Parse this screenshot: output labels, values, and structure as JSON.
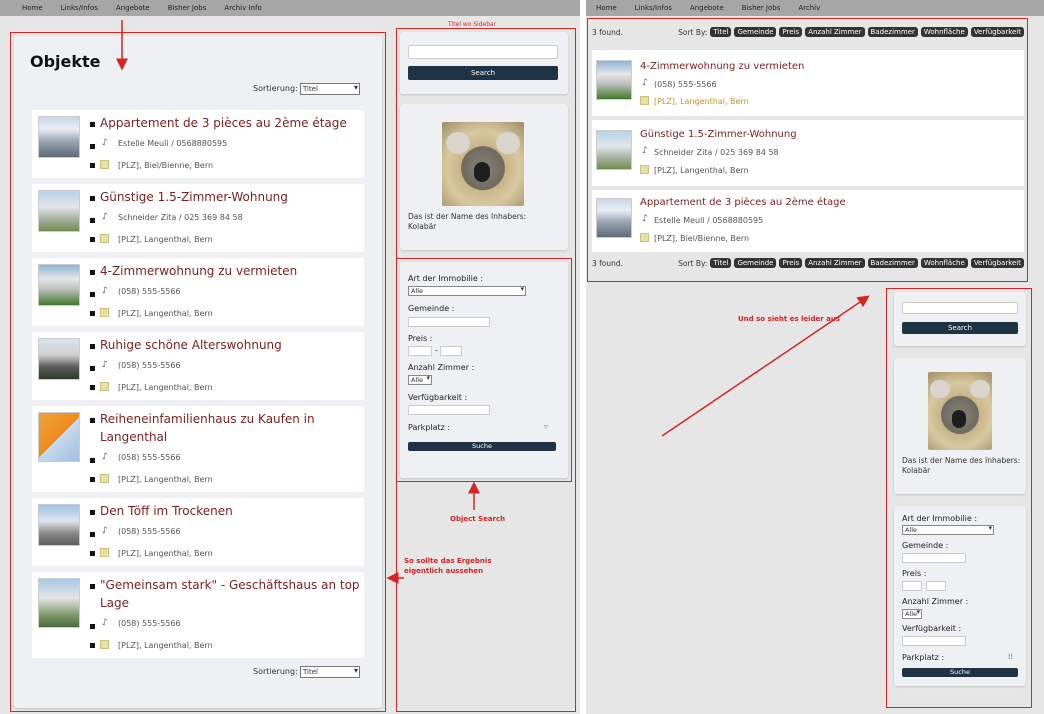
{
  "left": {
    "nav": [
      "Home",
      "Links/Infos",
      "Angebote",
      "Bisher Jobs",
      "Archiv Info"
    ],
    "page_title": "Objekte",
    "sort_label": "Sortierung:",
    "sort_value": "Titel",
    "items": [
      {
        "title": "Appartement de 3 pièces au 2ème étage",
        "title2": "",
        "contact": "Estelle Meuli / 0568880595",
        "location": "[PLZ], Biel/Bienne, Bern"
      },
      {
        "title": "Günstige 1.5-Zimmer-Wohnung",
        "title2": "",
        "contact": "Schneider Zita / 025 369 84 58",
        "location": "[PLZ], Langenthal, Bern"
      },
      {
        "title": "4-Zimmerwohnung zu vermieten",
        "title2": "",
        "contact": "(058) 555-5566",
        "location": "[PLZ], Langenthal, Bern"
      },
      {
        "title": "Ruhige schöne Alterswohnung",
        "title2": "",
        "contact": "(058) 555-5566",
        "location": "[PLZ], Langenthal, Bern"
      },
      {
        "title": "Reiheneinfamilienhaus zu Kaufen in",
        "title2": "Langenthal",
        "contact": "(058) 555-5566",
        "location": "[PLZ], Langenthal, Bern"
      },
      {
        "title": "Den Töff im Trockenen",
        "title2": "",
        "contact": "(058) 555-5566",
        "location": "[PLZ], Langenthal, Bern"
      },
      {
        "title": "\"Gemeinsam stark\" - Geschäftshaus an top",
        "title2": "Lage",
        "contact": "(058) 555-5566",
        "location": "[PLZ], Langenthal, Bern"
      }
    ],
    "sidebar": {
      "search_button": "Search",
      "owner_caption": "Das ist der Name des Inhabers:",
      "owner_name": "Kolabär",
      "filter": {
        "art_label": "Art der Immobilie :",
        "art_value": "Alle",
        "gemeinde_label": "Gemeinde :",
        "preis_label": "Preis :",
        "preis_sep": "-",
        "zimmer_label": "Anzahl Zimmer :",
        "zimmer_value": "Alle",
        "verfuegbar_label": "Verfügbarkeit :",
        "parkplatz_label": "Parkplatz :",
        "submit": "Suche"
      }
    },
    "annotations": {
      "top_hint": "Titel wo Sidebar",
      "object_search": "Object Search",
      "result_hint_1": "So sollte das Ergebnis",
      "result_hint_2": "eigentlich aussehen"
    }
  },
  "right": {
    "nav": [
      "Home",
      "Links/Infos",
      "Angebote",
      "Bisher Jobs",
      "Archiv"
    ],
    "found": "3 found.",
    "sort_by": "Sort By:",
    "sort_pills": [
      "Titel",
      "Gemeinde",
      "Preis",
      "Anzahl Zimmer",
      "Badezimmer",
      "Wohnfläche",
      "Verfügbarkeit"
    ],
    "results": [
      {
        "title": "4-Zimmerwohnung zu vermieten",
        "contact": "(058) 555-5566",
        "location": "[PLZ], Langenthal, Bern"
      },
      {
        "title": "Günstige 1.5-Zimmer-Wohnung",
        "contact": "Schneider Zita / 025 369 84 58",
        "location": "[PLZ], Langenthal, Bern"
      },
      {
        "title": "Appartement de 3 pièces au 2ème étage",
        "contact": "Estelle Meuli / 0568880595",
        "location": "[PLZ], Biel/Bienne, Bern"
      }
    ],
    "annotation": "Und so sieht es leider aus",
    "sidebar": {
      "search_button": "Search",
      "owner_caption": "Das ist der Name des Inhabers:",
      "owner_name": "Kolabär",
      "filter": {
        "art_label": "Art der Immobilie :",
        "art_value": "Alle",
        "gemeinde_label": "Gemeinde :",
        "preis_label": "Preis :",
        "zimmer_label": "Anzahl Zimmer :",
        "zimmer_value": "Alle",
        "verfuegbar_label": "Verfügbarkeit :",
        "parkplatz_label": "Parkplatz :",
        "submit": "Suche"
      }
    }
  },
  "colors": {
    "accent_red": "#d42424",
    "title_brown": "#7a1f1f",
    "button_dark": "#1f3344"
  }
}
